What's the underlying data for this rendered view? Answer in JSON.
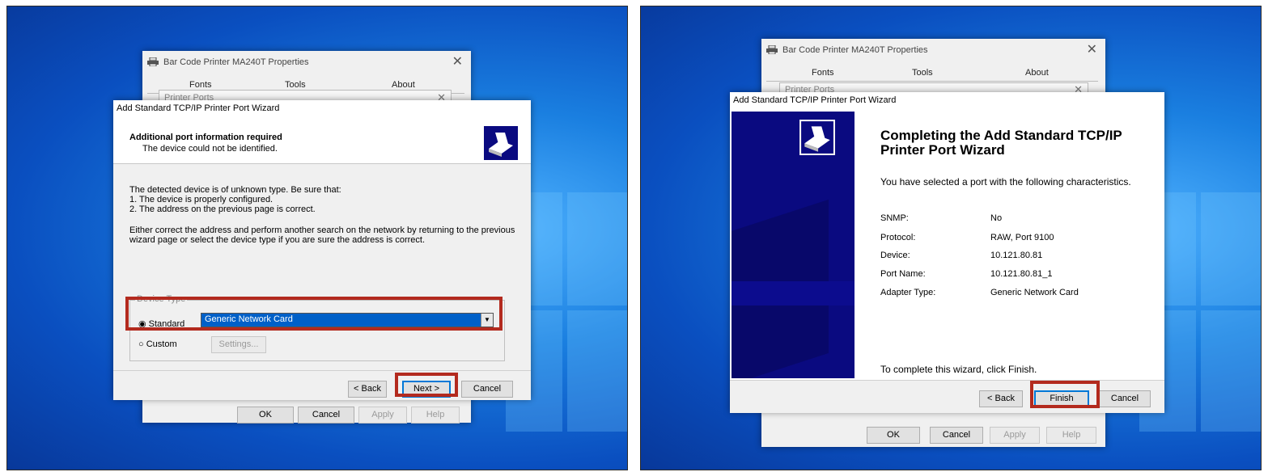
{
  "left": {
    "props_dialog": {
      "title": "Bar Code Printer MA240T Properties",
      "tabs": [
        "Fonts",
        "Tools",
        "About"
      ],
      "sub_dialog_title": "Printer Ports",
      "buttons": {
        "ok": "OK",
        "cancel": "Cancel",
        "apply": "Apply",
        "help": "Help"
      }
    },
    "wizard": {
      "title": "Add Standard TCP/IP Printer Port Wizard",
      "header_title": "Additional port information required",
      "header_subtitle": "The device could not be identified.",
      "body_line1": "The detected device is of unknown type.  Be sure that:",
      "body_line2": "1. The device is properly configured.",
      "body_line3": "2. The address on the previous page is correct.",
      "body_para2_line1": "Either correct the address and perform another search on the network by returning to the previous",
      "body_para2_line2": "wizard page or select the device type if you are sure the address is correct.",
      "group_label": "Device Type",
      "standard_label": "Standard",
      "standard_value": "Generic Network Card",
      "custom_label": "Custom",
      "settings_button": "Settings...",
      "back_button": "< Back",
      "next_button": "Next >",
      "cancel_button": "Cancel"
    }
  },
  "right": {
    "props_dialog": {
      "title": "Bar Code Printer MA240T Properties",
      "tabs": [
        "Fonts",
        "Tools",
        "About"
      ],
      "sub_dialog_title": "Printer Ports",
      "buttons": {
        "ok": "OK",
        "cancel": "Cancel",
        "apply": "Apply",
        "help": "Help"
      }
    },
    "wizard": {
      "title": "Add Standard TCP/IP Printer Port Wizard",
      "heading_line1": "Completing the Add Standard TCP/IP",
      "heading_line2": "Printer Port Wizard",
      "intro": "You have selected a port with the following characteristics.",
      "details": [
        {
          "label": "SNMP:",
          "value": "No"
        },
        {
          "label": "Protocol:",
          "value": "RAW, Port 9100"
        },
        {
          "label": "Device:",
          "value": "10.121.80.81"
        },
        {
          "label": "Port Name:",
          "value": "10.121.80.81_1"
        },
        {
          "label": "Adapter Type:",
          "value": "Generic Network Card"
        }
      ],
      "finish_hint": "To complete this wizard, click Finish.",
      "back_button": "< Back",
      "finish_button": "Finish",
      "cancel_button": "Cancel"
    }
  },
  "colors": {
    "highlight": "#b32a1e",
    "wizard_banner": "#0a0a80",
    "desktop": "#1a7fe0"
  },
  "icons": [
    "printer-icon",
    "close-icon",
    "wizard-printer-icon",
    "dropdown-arrow-icon",
    "radio-icon"
  ]
}
